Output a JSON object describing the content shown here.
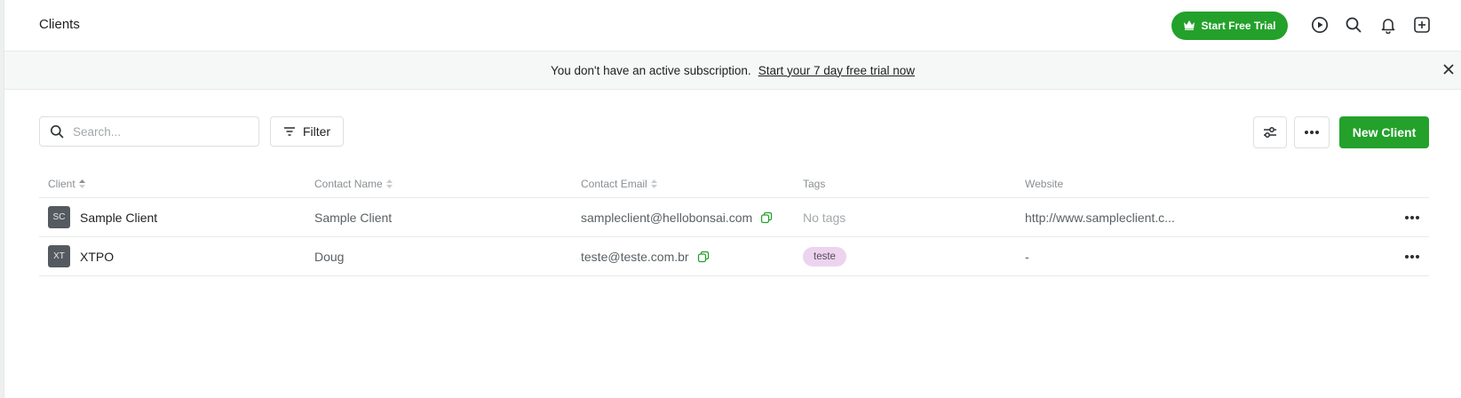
{
  "header": {
    "title": "Clients",
    "trial_button": "Start Free Trial",
    "icons": [
      "play-circle-icon",
      "search-icon",
      "bell-icon",
      "plus-square-icon"
    ]
  },
  "banner": {
    "message": "You don't have an active subscription.",
    "link": "Start your 7 day free trial now"
  },
  "toolbar": {
    "search_placeholder": "Search...",
    "search_value": "",
    "filter_label": "Filter",
    "new_client_label": "New Client"
  },
  "table": {
    "columns": {
      "client": "Client",
      "contact_name": "Contact Name",
      "contact_email": "Contact Email",
      "tags": "Tags",
      "website": "Website"
    },
    "rows": [
      {
        "initials": "SC",
        "client": "Sample Client",
        "contact_name": "Sample Client",
        "contact_email": "sampleclient@hellobonsai.com",
        "tags": "No tags",
        "website": "http://www.sampleclient.c..."
      },
      {
        "initials": "XT",
        "client": "XTPO",
        "contact_name": "Doug",
        "contact_email": "teste@teste.com.br",
        "tags": "teste",
        "website": "-"
      }
    ]
  },
  "colors": {
    "accent": "#23a12b",
    "tag_bg": "#ecd4ef",
    "avatar_bg": "#545a5f"
  }
}
